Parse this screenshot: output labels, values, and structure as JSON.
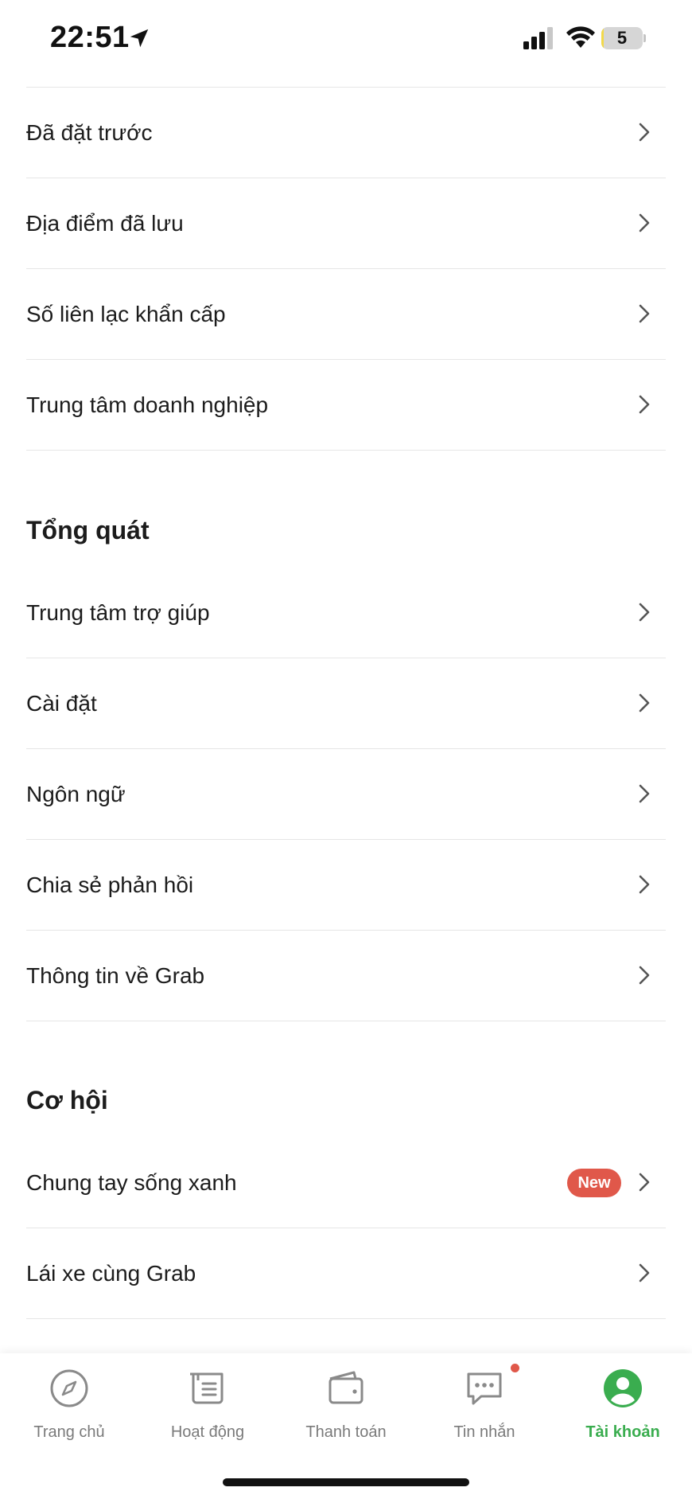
{
  "status_bar": {
    "time": "22:51",
    "battery_level": "5",
    "battery_fraction": 0.05
  },
  "menu": {
    "items_top": [
      {
        "label": "Đã đặt trước"
      },
      {
        "label": "Địa điểm đã lưu"
      },
      {
        "label": "Số liên lạc khẩn cấp"
      },
      {
        "label": "Trung tâm doanh nghiệp"
      }
    ],
    "general": {
      "title": "Tổng quát",
      "items": [
        {
          "label": "Trung tâm trợ giúp"
        },
        {
          "label": "Cài đặt"
        },
        {
          "label": "Ngôn ngữ"
        },
        {
          "label": "Chia sẻ phản hồi"
        },
        {
          "label": "Thông tin về Grab"
        }
      ]
    },
    "opportunity": {
      "title": "Cơ hội",
      "items": [
        {
          "label": "Chung tay sống xanh",
          "badge": "New"
        },
        {
          "label": "Lái xe cùng Grab"
        }
      ]
    }
  },
  "bottom_nav": {
    "items": [
      {
        "label": "Trang chủ",
        "icon": "compass-icon"
      },
      {
        "label": "Hoạt động",
        "icon": "list-icon"
      },
      {
        "label": "Thanh toán",
        "icon": "wallet-icon"
      },
      {
        "label": "Tin nhắn",
        "icon": "chat-icon",
        "notification": true
      },
      {
        "label": "Tài khoản",
        "icon": "account-icon",
        "active": true
      }
    ]
  },
  "colors": {
    "accent": "#3aad4f",
    "badge": "#e0584a",
    "text": "#1c1c1c",
    "muted": "#7a7a7a",
    "divider": "#e6e6e6"
  }
}
